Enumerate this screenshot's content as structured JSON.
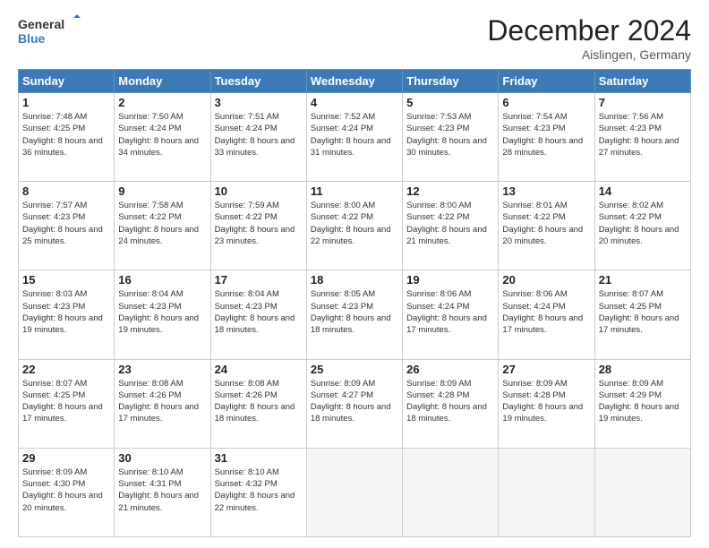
{
  "header": {
    "logo_line1": "General",
    "logo_line2": "Blue",
    "month_title": "December 2024",
    "location": "Aislingen, Germany"
  },
  "days_of_week": [
    "Sunday",
    "Monday",
    "Tuesday",
    "Wednesday",
    "Thursday",
    "Friday",
    "Saturday"
  ],
  "weeks": [
    [
      {
        "day": "1",
        "sunrise": "7:48 AM",
        "sunset": "4:25 PM",
        "daylight": "8 hours and 36 minutes."
      },
      {
        "day": "2",
        "sunrise": "7:50 AM",
        "sunset": "4:24 PM",
        "daylight": "8 hours and 34 minutes."
      },
      {
        "day": "3",
        "sunrise": "7:51 AM",
        "sunset": "4:24 PM",
        "daylight": "8 hours and 33 minutes."
      },
      {
        "day": "4",
        "sunrise": "7:52 AM",
        "sunset": "4:24 PM",
        "daylight": "8 hours and 31 minutes."
      },
      {
        "day": "5",
        "sunrise": "7:53 AM",
        "sunset": "4:23 PM",
        "daylight": "8 hours and 30 minutes."
      },
      {
        "day": "6",
        "sunrise": "7:54 AM",
        "sunset": "4:23 PM",
        "daylight": "8 hours and 28 minutes."
      },
      {
        "day": "7",
        "sunrise": "7:56 AM",
        "sunset": "4:23 PM",
        "daylight": "8 hours and 27 minutes."
      }
    ],
    [
      {
        "day": "8",
        "sunrise": "7:57 AM",
        "sunset": "4:23 PM",
        "daylight": "8 hours and 25 minutes."
      },
      {
        "day": "9",
        "sunrise": "7:58 AM",
        "sunset": "4:22 PM",
        "daylight": "8 hours and 24 minutes."
      },
      {
        "day": "10",
        "sunrise": "7:59 AM",
        "sunset": "4:22 PM",
        "daylight": "8 hours and 23 minutes."
      },
      {
        "day": "11",
        "sunrise": "8:00 AM",
        "sunset": "4:22 PM",
        "daylight": "8 hours and 22 minutes."
      },
      {
        "day": "12",
        "sunrise": "8:00 AM",
        "sunset": "4:22 PM",
        "daylight": "8 hours and 21 minutes."
      },
      {
        "day": "13",
        "sunrise": "8:01 AM",
        "sunset": "4:22 PM",
        "daylight": "8 hours and 20 minutes."
      },
      {
        "day": "14",
        "sunrise": "8:02 AM",
        "sunset": "4:22 PM",
        "daylight": "8 hours and 20 minutes."
      }
    ],
    [
      {
        "day": "15",
        "sunrise": "8:03 AM",
        "sunset": "4:23 PM",
        "daylight": "8 hours and 19 minutes."
      },
      {
        "day": "16",
        "sunrise": "8:04 AM",
        "sunset": "4:23 PM",
        "daylight": "8 hours and 19 minutes."
      },
      {
        "day": "17",
        "sunrise": "8:04 AM",
        "sunset": "4:23 PM",
        "daylight": "8 hours and 18 minutes."
      },
      {
        "day": "18",
        "sunrise": "8:05 AM",
        "sunset": "4:23 PM",
        "daylight": "8 hours and 18 minutes."
      },
      {
        "day": "19",
        "sunrise": "8:06 AM",
        "sunset": "4:24 PM",
        "daylight": "8 hours and 17 minutes."
      },
      {
        "day": "20",
        "sunrise": "8:06 AM",
        "sunset": "4:24 PM",
        "daylight": "8 hours and 17 minutes."
      },
      {
        "day": "21",
        "sunrise": "8:07 AM",
        "sunset": "4:25 PM",
        "daylight": "8 hours and 17 minutes."
      }
    ],
    [
      {
        "day": "22",
        "sunrise": "8:07 AM",
        "sunset": "4:25 PM",
        "daylight": "8 hours and 17 minutes."
      },
      {
        "day": "23",
        "sunrise": "8:08 AM",
        "sunset": "4:26 PM",
        "daylight": "8 hours and 17 minutes."
      },
      {
        "day": "24",
        "sunrise": "8:08 AM",
        "sunset": "4:26 PM",
        "daylight": "8 hours and 18 minutes."
      },
      {
        "day": "25",
        "sunrise": "8:09 AM",
        "sunset": "4:27 PM",
        "daylight": "8 hours and 18 minutes."
      },
      {
        "day": "26",
        "sunrise": "8:09 AM",
        "sunset": "4:28 PM",
        "daylight": "8 hours and 18 minutes."
      },
      {
        "day": "27",
        "sunrise": "8:09 AM",
        "sunset": "4:28 PM",
        "daylight": "8 hours and 19 minutes."
      },
      {
        "day": "28",
        "sunrise": "8:09 AM",
        "sunset": "4:29 PM",
        "daylight": "8 hours and 19 minutes."
      }
    ],
    [
      {
        "day": "29",
        "sunrise": "8:09 AM",
        "sunset": "4:30 PM",
        "daylight": "8 hours and 20 minutes."
      },
      {
        "day": "30",
        "sunrise": "8:10 AM",
        "sunset": "4:31 PM",
        "daylight": "8 hours and 21 minutes."
      },
      {
        "day": "31",
        "sunrise": "8:10 AM",
        "sunset": "4:32 PM",
        "daylight": "8 hours and 22 minutes."
      },
      null,
      null,
      null,
      null
    ]
  ],
  "labels": {
    "sunrise": "Sunrise:",
    "sunset": "Sunset:",
    "daylight": "Daylight:"
  }
}
